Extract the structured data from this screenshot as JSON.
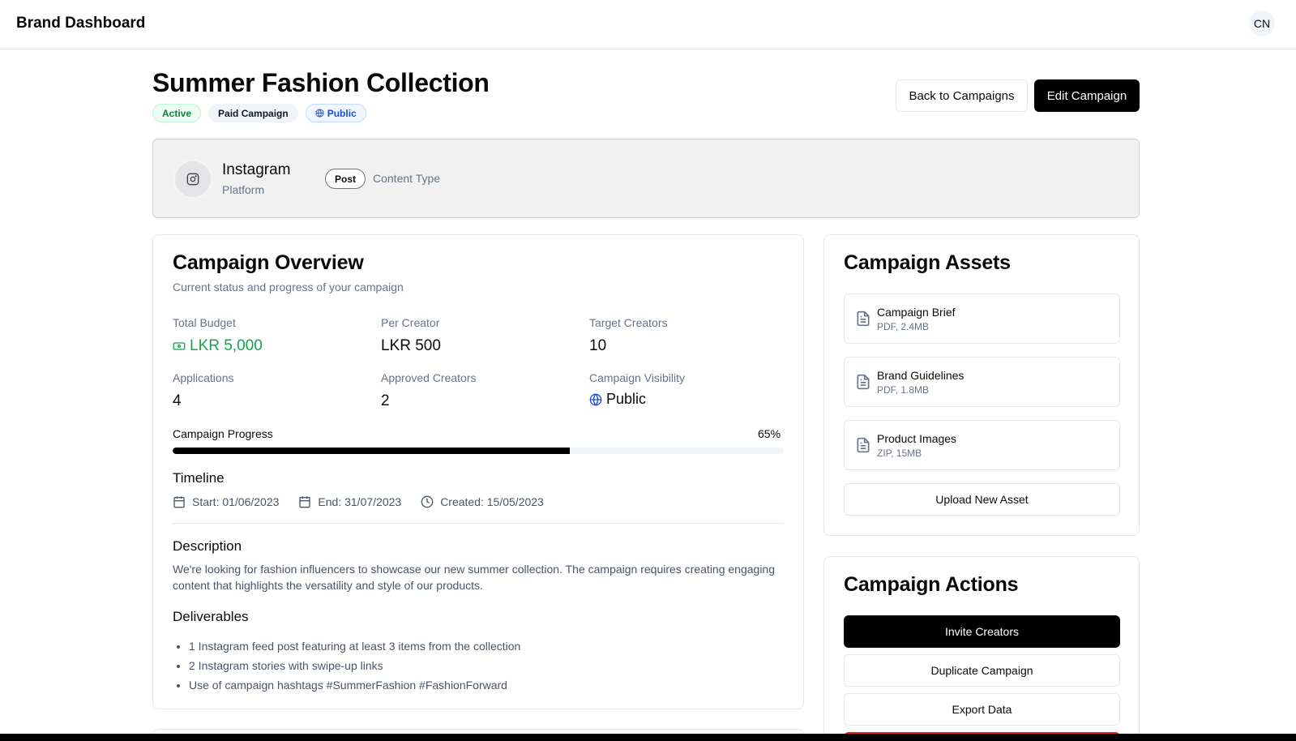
{
  "header": {
    "brand": "Brand Dashboard",
    "avatar_initials": "CN"
  },
  "campaign": {
    "title": "Summer Fashion Collection",
    "badges": {
      "status": "Active",
      "type": "Paid Campaign",
      "visibility": "Public"
    },
    "back_label": "Back to Campaigns",
    "edit_label": "Edit Campaign"
  },
  "platform": {
    "name": "Instagram",
    "sub": "Platform",
    "content_pill": "Post",
    "content_label": "Content Type",
    "icon": "instagram-icon"
  },
  "overview": {
    "title": "Campaign Overview",
    "subtitle": "Current status and progress of your campaign",
    "stats": {
      "total_budget_label": "Total Budget",
      "total_budget": "LKR 5,000",
      "per_creator_label": "Per Creator",
      "per_creator": "LKR 500",
      "target_label": "Target Creators",
      "target": "10",
      "applications_label": "Applications",
      "applications": "4",
      "approved_label": "Approved Creators",
      "approved": "2",
      "visibility_label": "Campaign Visibility",
      "visibility": "Public"
    },
    "progress": {
      "label": "Campaign Progress",
      "value_text": "65%",
      "value": 65
    },
    "timeline": {
      "heading": "Timeline",
      "start": "Start: 01/06/2023",
      "end": "End: 31/07/2023",
      "created": "Created: 15/05/2023"
    },
    "description": {
      "heading": "Description",
      "text": "We're looking for fashion influencers to showcase our new summer collection. The campaign requires creating engaging content that highlights the versatility and style of our products."
    },
    "deliverables": {
      "heading": "Deliverables",
      "items": [
        "1 Instagram feed post featuring at least 3 items from the collection",
        "2 Instagram stories with swipe-up links",
        "Use of campaign hashtags #SummerFashion #FashionForward"
      ]
    }
  },
  "assets": {
    "title": "Campaign Assets",
    "items": [
      {
        "name": "Campaign Brief",
        "meta": "PDF, 2.4MB"
      },
      {
        "name": "Brand Guidelines",
        "meta": "PDF, 1.8MB"
      },
      {
        "name": "Product Images",
        "meta": "ZIP, 15MB"
      }
    ],
    "upload_label": "Upload New Asset"
  },
  "actions": {
    "title": "Campaign Actions",
    "invite_label": "Invite Creators",
    "duplicate_label": "Duplicate Campaign",
    "export_label": "Export Data"
  },
  "colors": {
    "accent_green": "#16a34a",
    "accent_blue": "#1d4ed8",
    "danger": "#dc2626",
    "primary": "#000000"
  }
}
